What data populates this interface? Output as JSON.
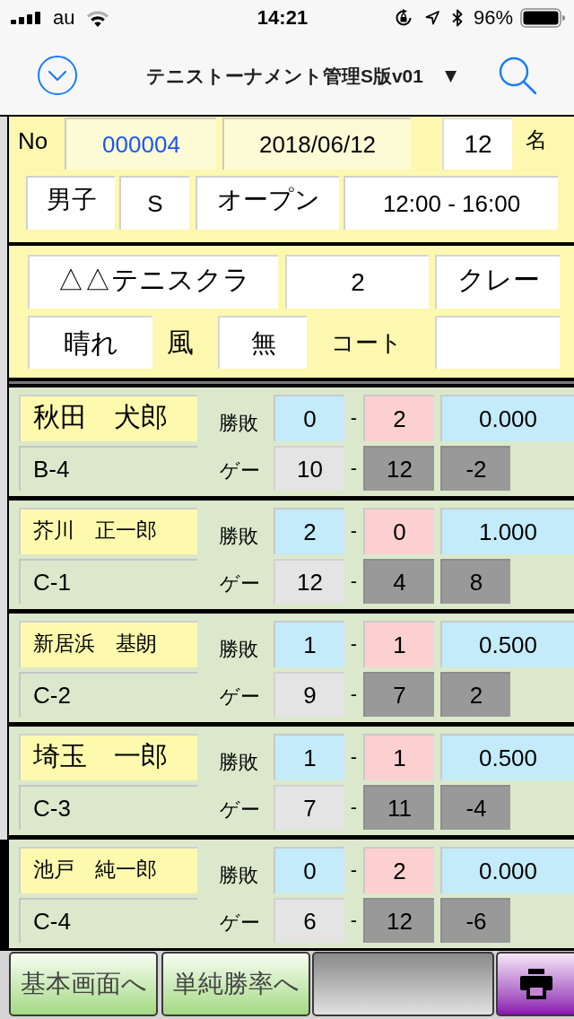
{
  "status_bar": {
    "carrier": "au",
    "time": "14:21",
    "battery": "96%"
  },
  "nav_bar": {
    "title": "テニストーナメント管理S版v01",
    "title_arrow": "▼"
  },
  "header": {
    "no_label": "No",
    "number": "000004",
    "date": "2018/06/12",
    "count": "12",
    "count_unit": "名",
    "gender": "男子",
    "event": "S",
    "category": "オープン",
    "time": "12:00 - 16:00"
  },
  "venue": {
    "club": "△△テニスクラ",
    "courts": "2",
    "surface": "クレー",
    "weather": "晴れ",
    "wind_label": "風",
    "wind": "無",
    "court_label": "コート"
  },
  "players": [
    {
      "selected": false,
      "name": "秋田　犬郎",
      "code": "B-4",
      "match_label": "勝敗",
      "wins": "0",
      "match_sep": "-",
      "losses": "2",
      "rate": "0.000",
      "game_label": "ゲー",
      "games_won": "10",
      "game_sep": "-",
      "games_lost": "12",
      "game_diff": "-2"
    },
    {
      "selected": false,
      "name": "芥川　正一郎",
      "code": "C-1",
      "match_label": "勝敗",
      "wins": "2",
      "match_sep": "-",
      "losses": "0",
      "rate": "1.000",
      "game_label": "ゲー",
      "games_won": "12",
      "game_sep": "-",
      "games_lost": "4",
      "game_diff": "8"
    },
    {
      "selected": false,
      "name": "新居浜　基朗",
      "code": "C-2",
      "match_label": "勝敗",
      "wins": "1",
      "match_sep": "-",
      "losses": "1",
      "rate": "0.500",
      "game_label": "ゲー",
      "games_won": "9",
      "game_sep": "-",
      "games_lost": "7",
      "game_diff": "2"
    },
    {
      "selected": false,
      "name": "埼玉　一郎",
      "code": "C-3",
      "match_label": "勝敗",
      "wins": "1",
      "match_sep": "-",
      "losses": "1",
      "rate": "0.500",
      "game_label": "ゲー",
      "games_won": "7",
      "game_sep": "-",
      "games_lost": "11",
      "game_diff": "-4"
    },
    {
      "selected": true,
      "name": "池戸　純一郎",
      "code": "C-4",
      "match_label": "勝敗",
      "wins": "0",
      "match_sep": "-",
      "losses": "2",
      "rate": "0.000",
      "game_label": "ゲー",
      "games_won": "6",
      "game_sep": "-",
      "games_lost": "12",
      "game_diff": "-6"
    }
  ],
  "footer": {
    "buttons": [
      "基本画面へ",
      "単純勝率へ"
    ]
  }
}
